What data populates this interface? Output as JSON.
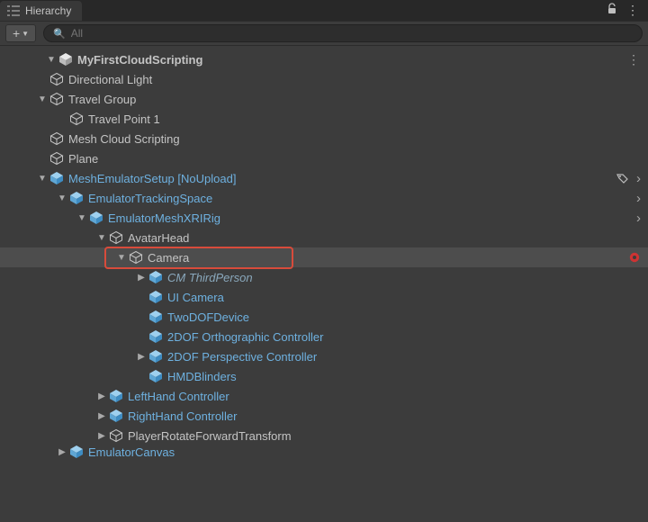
{
  "panel": {
    "title": "Hierarchy",
    "search_placeholder": "All"
  },
  "tree": {
    "scene": {
      "name": "MyFirstCloudScripting",
      "children": [
        {
          "name": "Directional Light"
        },
        {
          "name": "Travel Group",
          "expanded": true,
          "children": [
            {
              "name": "Travel Point 1"
            }
          ]
        },
        {
          "name": "Mesh Cloud Scripting"
        },
        {
          "name": "Plane"
        },
        {
          "name": "MeshEmulatorSetup [NoUpload]",
          "prefab": true,
          "expanded": true,
          "has_tag_icon": true,
          "has_open_chevron": true,
          "children": [
            {
              "name": "EmulatorTrackingSpace",
              "prefab": true,
              "expanded": true,
              "has_open_chevron": true,
              "children": [
                {
                  "name": "EmulatorMeshXRIRig",
                  "prefab": true,
                  "expanded": true,
                  "has_open_chevron": true,
                  "children": [
                    {
                      "name": "AvatarHead",
                      "expanded": true,
                      "children": [
                        {
                          "name": "Camera",
                          "expanded": true,
                          "selected": true,
                          "highlight_red": true,
                          "has_gear": true,
                          "children": [
                            {
                              "name": "CM ThirdPerson",
                              "italic": true,
                              "prefab": true,
                              "has_children_collapsed": true
                            },
                            {
                              "name": "UI Camera",
                              "prefab": true
                            },
                            {
                              "name": "TwoDOFDevice",
                              "prefab": true
                            },
                            {
                              "name": "2DOF Orthographic Controller",
                              "prefab": true
                            },
                            {
                              "name": "2DOF Perspective Controller",
                              "prefab": true,
                              "has_children_collapsed": true
                            },
                            {
                              "name": "HMDBlinders",
                              "prefab": true
                            }
                          ]
                        }
                      ]
                    },
                    {
                      "name": "LeftHand Controller",
                      "prefab": true,
                      "has_children_collapsed": true
                    },
                    {
                      "name": "RightHand Controller",
                      "prefab": true,
                      "has_children_collapsed": true
                    },
                    {
                      "name": "PlayerRotateForwardTransform",
                      "has_children_collapsed": true
                    }
                  ]
                }
              ]
            },
            {
              "name": "EmulatorCanvas",
              "prefab": true,
              "has_children_collapsed": true,
              "cut": true
            }
          ]
        }
      ]
    }
  }
}
